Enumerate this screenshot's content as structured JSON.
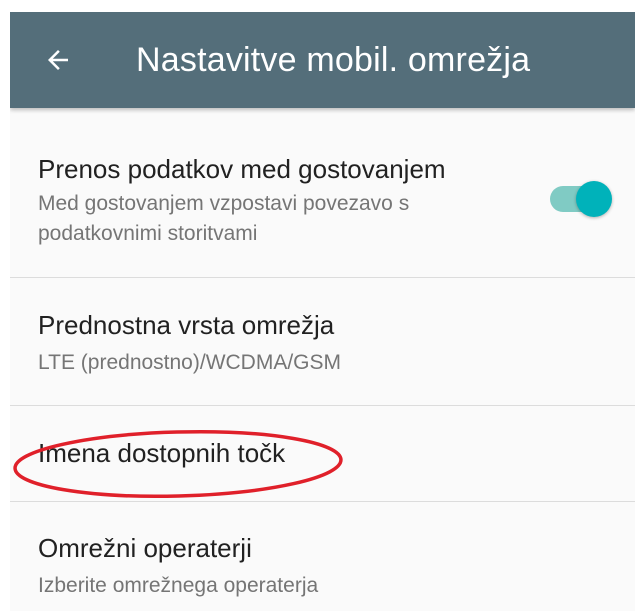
{
  "appbar": {
    "title": "Nastavitve mobil. omrežja",
    "back_icon": "arrow-back-icon",
    "color": "#546e7a"
  },
  "settings": [
    {
      "title": "Prenos podatkov med gostovanjem",
      "summary": "Med gostovanjem vzpostavi povezavo s podatkovnimi storitvami",
      "toggle": {
        "state": "on",
        "accent": "#00b2ba"
      }
    },
    {
      "title": "Prednostna vrsta omrežja",
      "summary": "LTE (prednostno)/WCDMA/GSM"
    },
    {
      "title": "Imena dostopnih točk",
      "highlighted": true,
      "highlight_color": "#e0202a"
    },
    {
      "title": "Omrežni operaterji",
      "summary": "Izberite omrežnega operaterja"
    }
  ]
}
